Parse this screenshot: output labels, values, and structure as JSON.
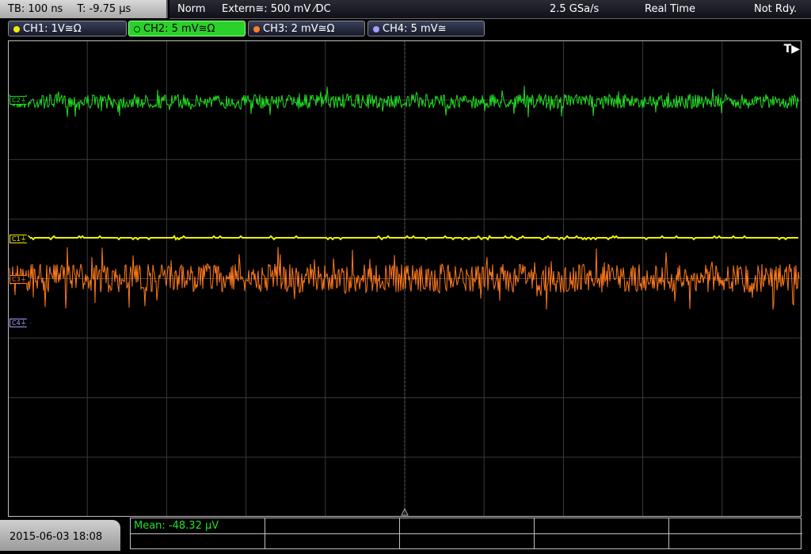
{
  "header": {
    "timebase": "TB: 100 ns",
    "trigger_time": "T: -9.75 µs",
    "trigger_mode": "Norm",
    "trigger_source": "Extern≅: 500 mV ⁄DC",
    "sample_rate": "2.5 GSa/s",
    "acq_mode": "Real Time",
    "status": "Not Rdy."
  },
  "channels": [
    {
      "label": "CH1: 1V≅Ω",
      "color": "#f0f000",
      "marker": "C1⏚"
    },
    {
      "label": "CH2: 5 mV≅Ω",
      "color": "#22dd22",
      "marker": "C2⏚",
      "active": true
    },
    {
      "label": "CH3: 2 mV≅Ω",
      "color": "#ff8020",
      "marker": "C3⏚"
    },
    {
      "label": "CH4: 5 mV≅",
      "color": "#a0a0ff",
      "marker": "C4⏚"
    }
  ],
  "grid": {
    "trigger_position_marker": "T▶"
  },
  "footer": {
    "datetime": "2015-06-03 18:08",
    "measurement": "Mean: -48.32 µV"
  }
}
